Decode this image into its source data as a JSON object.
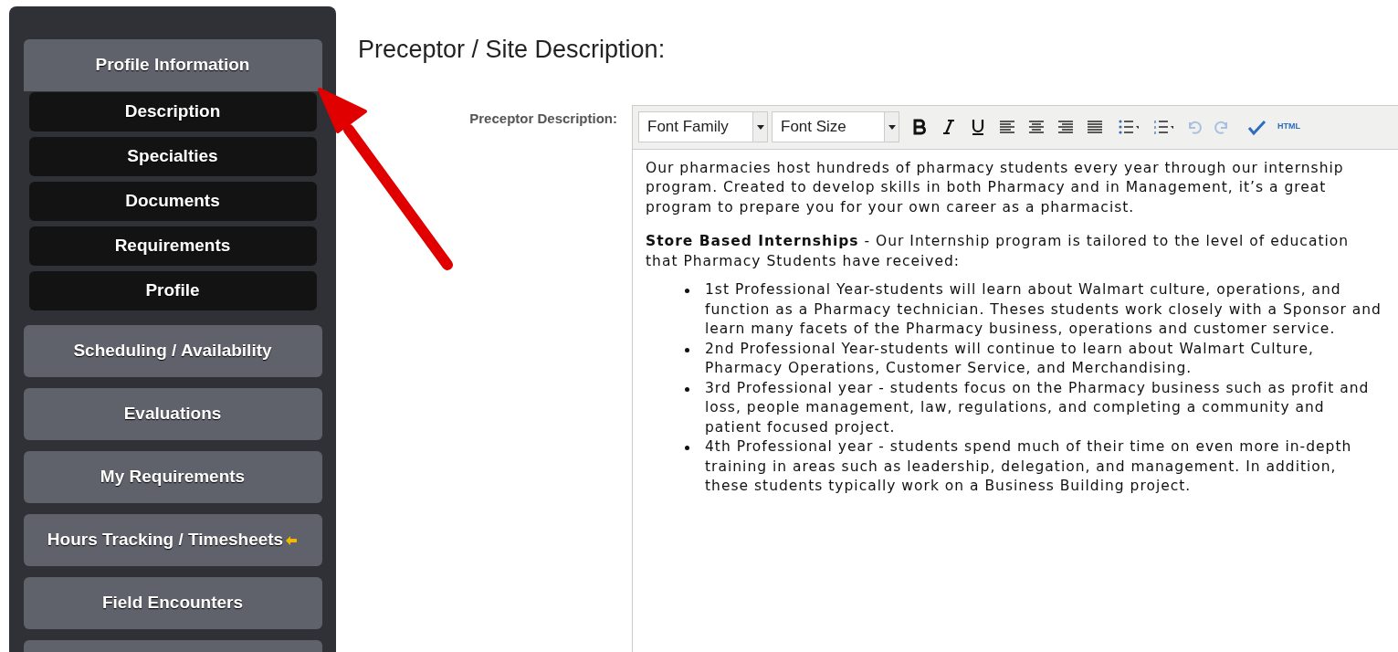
{
  "sidebar": {
    "items": [
      {
        "label": "Profile Information",
        "expanded": true,
        "children": [
          {
            "label": "Description"
          },
          {
            "label": "Specialties"
          },
          {
            "label": "Documents"
          },
          {
            "label": "Requirements"
          },
          {
            "label": "Profile"
          }
        ]
      },
      {
        "label": "Scheduling / Availability",
        "expanded": false
      },
      {
        "label": "Evaluations",
        "expanded": false
      },
      {
        "label": "My Requirements",
        "expanded": false
      },
      {
        "label": "Hours Tracking / Timesheets",
        "expanded": false,
        "kind": "flagged"
      },
      {
        "label": "Field Encounters",
        "expanded": false
      }
    ]
  },
  "page": {
    "title": "Preceptor / Site Description:",
    "field_label": "Preceptor Description:",
    "editor": {
      "font_family": "Font Family",
      "font_size": "Font Size",
      "html_button": "HTML",
      "paragraphs": [
        "Our pharmacies host hundreds of pharmacy students every year through our internship program. Created to develop skills in both Pharmacy and in Management, it’s a great program to prepare you for your own career as a pharmacist.",
        "**Store Based Internships** - Our Internship program is tailored to the level of education that Pharmacy Students have received:"
      ],
      "bullets": [
        "1st Professional Year-students will learn about Walmart culture, operations, and function as a Pharmacy technician. Theses students work closely with a Sponsor and learn many facets of the Pharmacy business, operations and customer service.",
        "2nd Professional Year-students will continue to learn about Walmart Culture, Pharmacy Operations, Customer Service, and Merchandising.",
        "3rd Professional year - students focus on the Pharmacy business such as profit and loss, people management, law, regulations, and completing a community and patient focused project.",
        "4th Professional year - students spend much of their time on even more in-depth training in areas such as leadership, delegation, and management. In addition, these students typically work on a Business Building project."
      ]
    }
  }
}
